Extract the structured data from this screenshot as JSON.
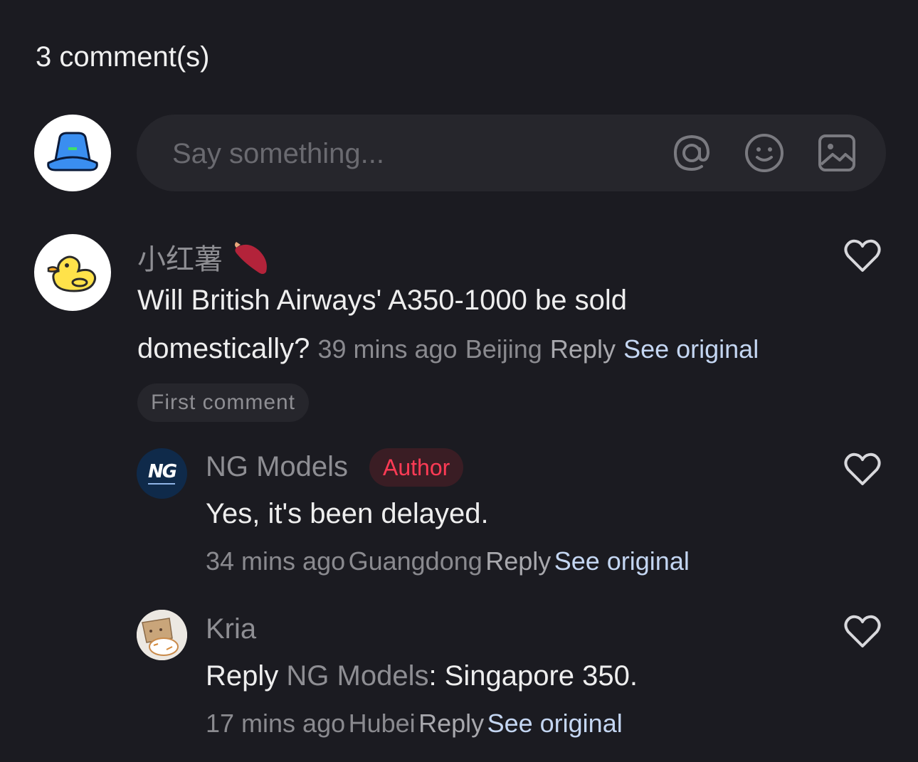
{
  "header": {
    "comment_count_label": "3 comment(s)"
  },
  "composer": {
    "placeholder": "Say something..."
  },
  "comments": [
    {
      "username": "小红薯",
      "text_line1": "Will British Airways' A350-1000 be sold",
      "text_line2": "domestically?",
      "time": "39 mins ago",
      "location": "Beijing",
      "reply_label": "Reply",
      "see_original_label": "See original",
      "tag": "First comment"
    },
    {
      "username": "NG Models",
      "badge": "Author",
      "avatar_text": "NG",
      "text": "Yes, it's been delayed.",
      "time": "34 mins ago",
      "location": "Guangdong",
      "reply_label": "Reply",
      "see_original_label": "See original"
    },
    {
      "username": "Kria",
      "reply_prefix": "Reply",
      "reply_target": "NG Models",
      "text": ": Singapore 350.",
      "time": "17 mins ago",
      "location": "Hubei",
      "reply_label": "Reply",
      "see_original_label": "See original"
    }
  ],
  "colors": {
    "background": "#1b1b21",
    "input_bg": "#26262c",
    "author_badge": "#ff3b55",
    "link": "#c4d6f2"
  },
  "icons": [
    "at-icon",
    "emoji-icon",
    "image-icon",
    "heart-icon",
    "hat-avatar-icon",
    "duck-avatar-icon",
    "sweet-potato-icon"
  ]
}
